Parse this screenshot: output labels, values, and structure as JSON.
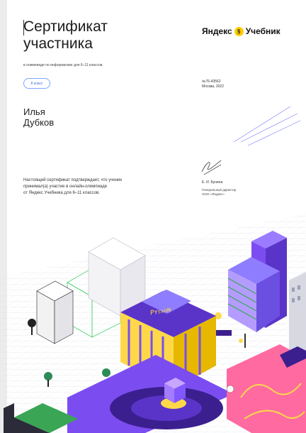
{
  "certificate": {
    "title_line1": "Сертификат",
    "title_line2": "участника",
    "subtitle": "в олимпиаде по информатике для 6–11 классов",
    "grade": "8 класс",
    "name_first": "Илья",
    "name_last": "Дубков",
    "statement_line1": "Настоящий сертификат подтверждает, что ученик",
    "statement_line2": "принимал(а) участие в онлайн-олимпиаде",
    "statement_line3": "от Яндекс Учебника для 6–11 классов."
  },
  "brand": {
    "name_left": "Яндекс",
    "name_right": "Учебник",
    "badge_glyph": "§",
    "accent": "#ffcc00"
  },
  "meta": {
    "number": "№76-43562",
    "place_year": "Москва, 2022"
  },
  "signer": {
    "name": "Е. И. Бунина",
    "role_line1": "Генеральный директор",
    "role_line2": "ООО «Яндекс»"
  },
  "illustration": {
    "building_sign": "Pʏᴛᴀᴏɴ",
    "colors": {
      "purple": "#7b4df0",
      "dark_purple": "#3b1f8f",
      "yellow": "#ffd84a",
      "pink": "#ff6aa0",
      "green": "#3aa655",
      "grid": "#d9dbe6"
    }
  }
}
